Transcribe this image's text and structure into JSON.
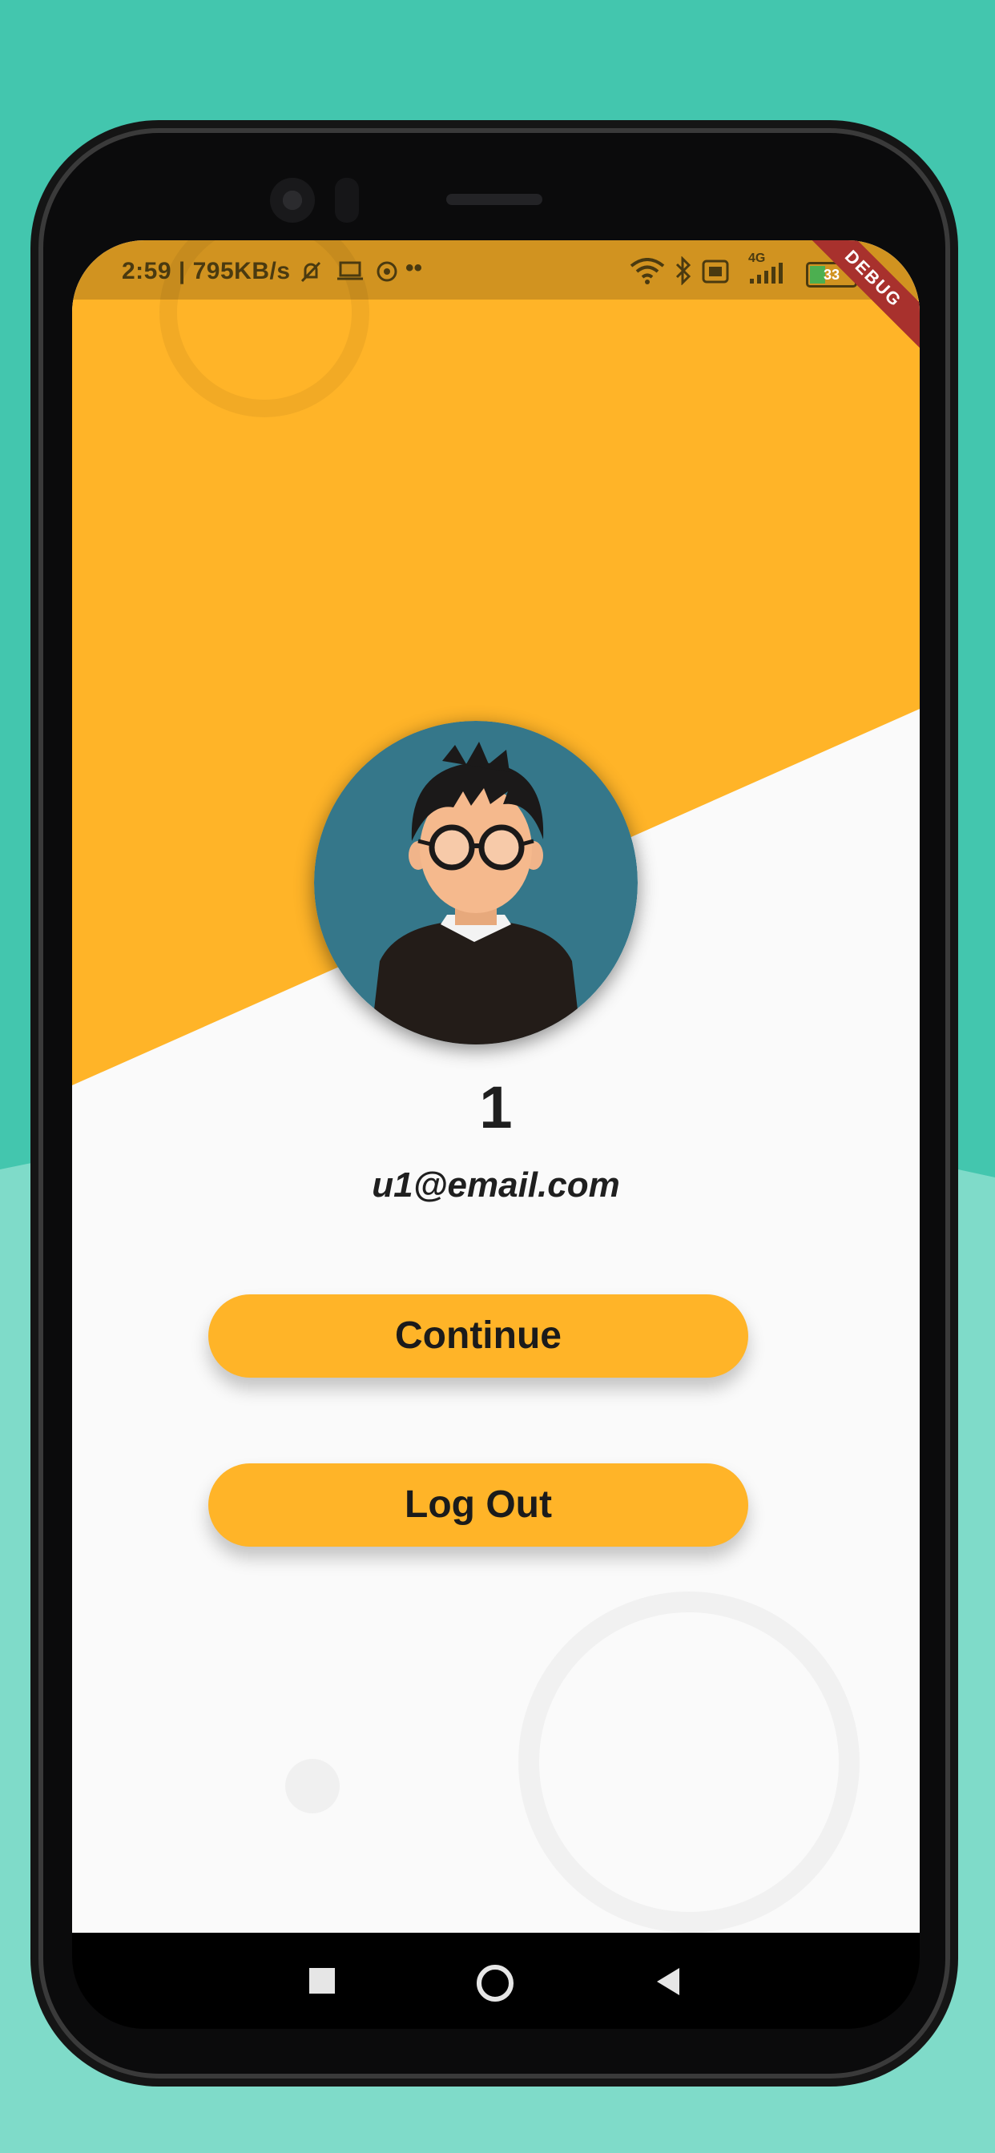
{
  "colors": {
    "background": "#43c6ae",
    "background_light": "#7fdbc9",
    "accent": "#ffb428",
    "screen_bg": "#fafafa",
    "text": "#1f1f1f",
    "debug_banner": "#a8312d"
  },
  "status_bar": {
    "time_speed": "2:59 | 795KB/s",
    "signal_label": "4G",
    "battery": "33",
    "battery_level": 0.33,
    "icons": [
      "bell-off-icon",
      "laptop-icon",
      "target-icon",
      "more-dots-icon",
      "wifi-icon",
      "bluetooth-icon",
      "volte-icon",
      "signal-icon",
      "battery-icon"
    ]
  },
  "debug_banner": "DEBUG",
  "profile": {
    "name": "1",
    "email": "u1@email.com"
  },
  "buttons": {
    "continue": "Continue",
    "logout": "Log Out"
  },
  "nav_bar": {
    "icons": [
      "recent-apps-icon",
      "home-icon",
      "back-icon"
    ]
  }
}
